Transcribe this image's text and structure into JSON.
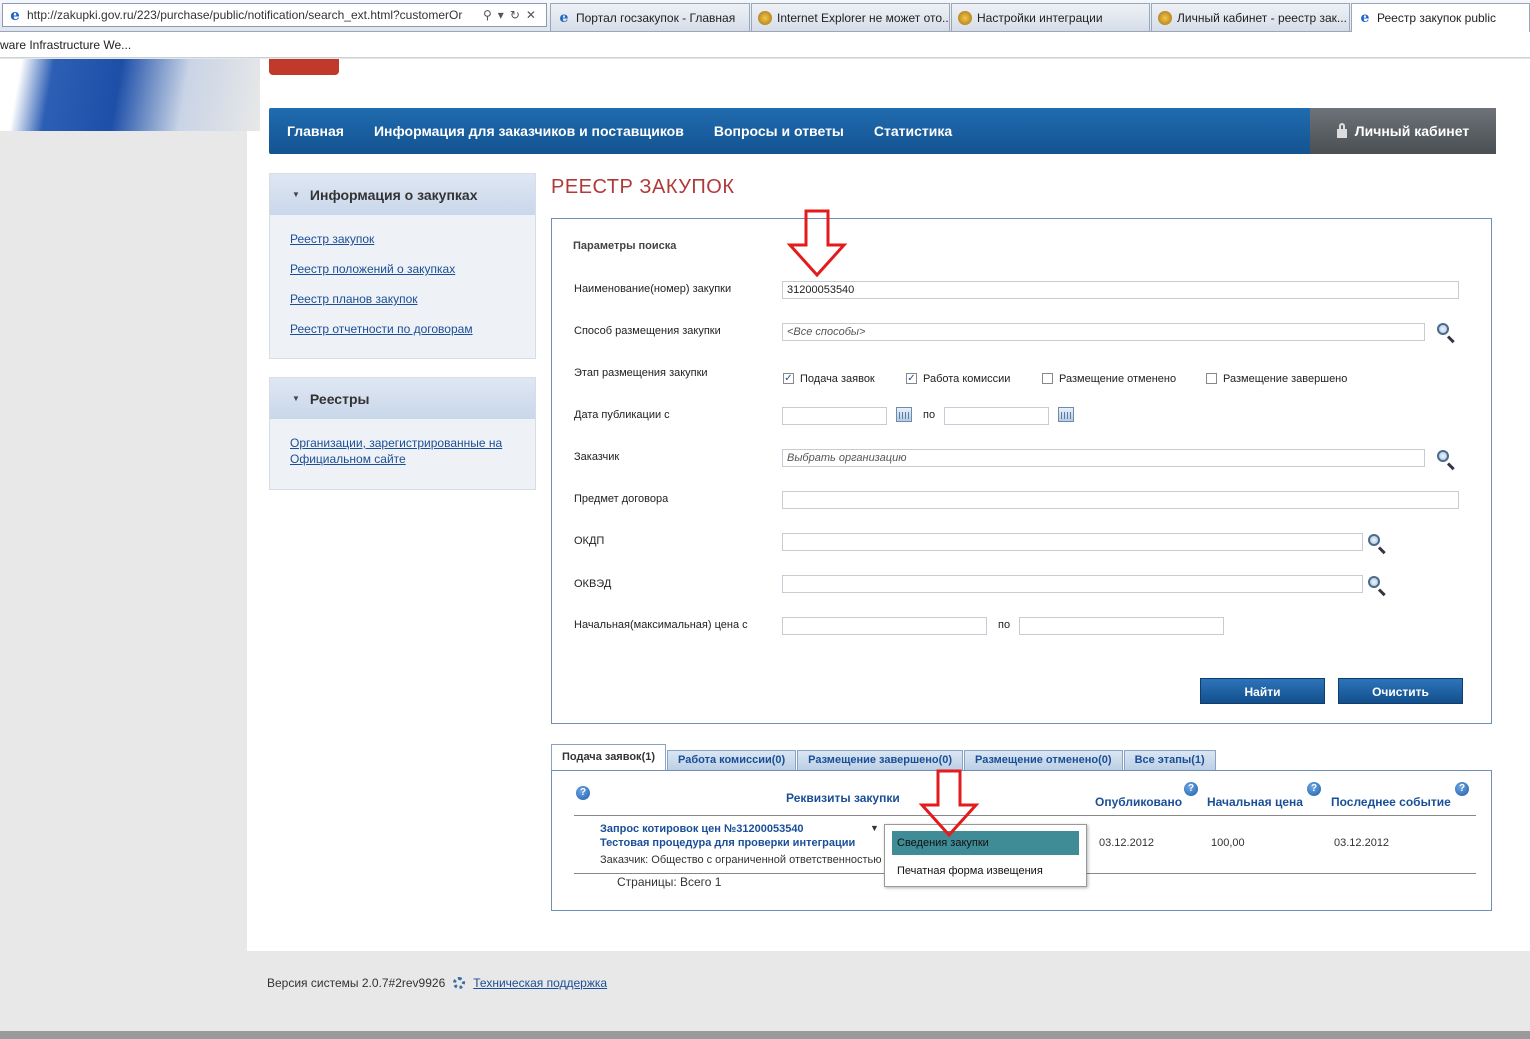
{
  "browser": {
    "address": "http://zakupki.gov.ru/223/purchase/public/notification/search_ext.html?customerOr",
    "tabs": [
      "Портал госзакупок - Главная",
      "Internet Explorer не может ото...",
      "Настройки интеграции",
      "Личный кабинет - реестр зак...",
      "Реестр закупок public"
    ],
    "favorites_item": "ware Infrastructure We..."
  },
  "nav": {
    "items": [
      "Главная",
      "Информация для заказчиков и поставщиков",
      "Вопросы и ответы",
      "Статистика"
    ],
    "cabinet": "Личный кабинет"
  },
  "sidebar": {
    "box1": {
      "title": "Информация о закупках",
      "links": [
        "Реестр закупок",
        "Реестр положений о закупках",
        "Реестр планов закупок",
        "Реестр отчетности по договорам"
      ]
    },
    "box2": {
      "title": "Реестры",
      "links": [
        "Организации, зарегистрированные на Официальном сайте"
      ]
    }
  },
  "page_title": "РЕЕСТР ЗАКУПОК",
  "search": {
    "params_label": "Параметры поиска",
    "name_label": "Наименование(номер) закупки",
    "name_value": "31200053540",
    "method_label": "Способ размещения закупки",
    "method_value": "<Все способы>",
    "stage_label": "Этап размещения закупки",
    "stages": [
      {
        "label": "Подача заявок",
        "checked": true
      },
      {
        "label": "Работа комиссии",
        "checked": true
      },
      {
        "label": "Размещение отменено",
        "checked": false
      },
      {
        "label": "Размещение завершено",
        "checked": false
      }
    ],
    "date_label": "Дата публикации с",
    "to_label": "по",
    "customer_label": "Заказчик",
    "customer_placeholder": "Выбрать организацию",
    "subject_label": "Предмет договора",
    "okdp_label": "ОКДП",
    "okved_label": "ОКВЭД",
    "price_label": "Начальная(максимальная) цена с",
    "find_button": "Найти",
    "clear_button": "Очистить"
  },
  "results": {
    "tabs": [
      "Подача заявок(1)",
      "Работа комиссии(0)",
      "Размещение завершено(0)",
      "Размещение отменено(0)",
      "Все этапы(1)"
    ],
    "headers": {
      "requisites": "Реквизиты закупки",
      "published": "Опубликовано",
      "price": "Начальная цена",
      "last_event": "Последнее событие"
    },
    "row": {
      "title_line1": "Запрос котировок цен  №31200053540",
      "title_line2": "Тестовая процедура для проверки интеграции",
      "customer": "Заказчик:  Общество с ограниченной ответственностью",
      "published": "03.12.2012",
      "price": "100,00",
      "last_event": "03.12.2012"
    },
    "pages": "Страницы: Всего 1",
    "dropdown": [
      "Сведения закупки",
      "Печатная форма извещения"
    ]
  },
  "footer": {
    "version": "Версия системы 2.0.7#2rev9926",
    "support": "Техническая поддержка"
  },
  "colors": {
    "nav_blue": "#1a5ea3",
    "title_red": "#b03a3a",
    "link_blue": "#1a4f98",
    "dropdown_selected": "#3f8b96",
    "arrow_red": "#e31b1b"
  }
}
